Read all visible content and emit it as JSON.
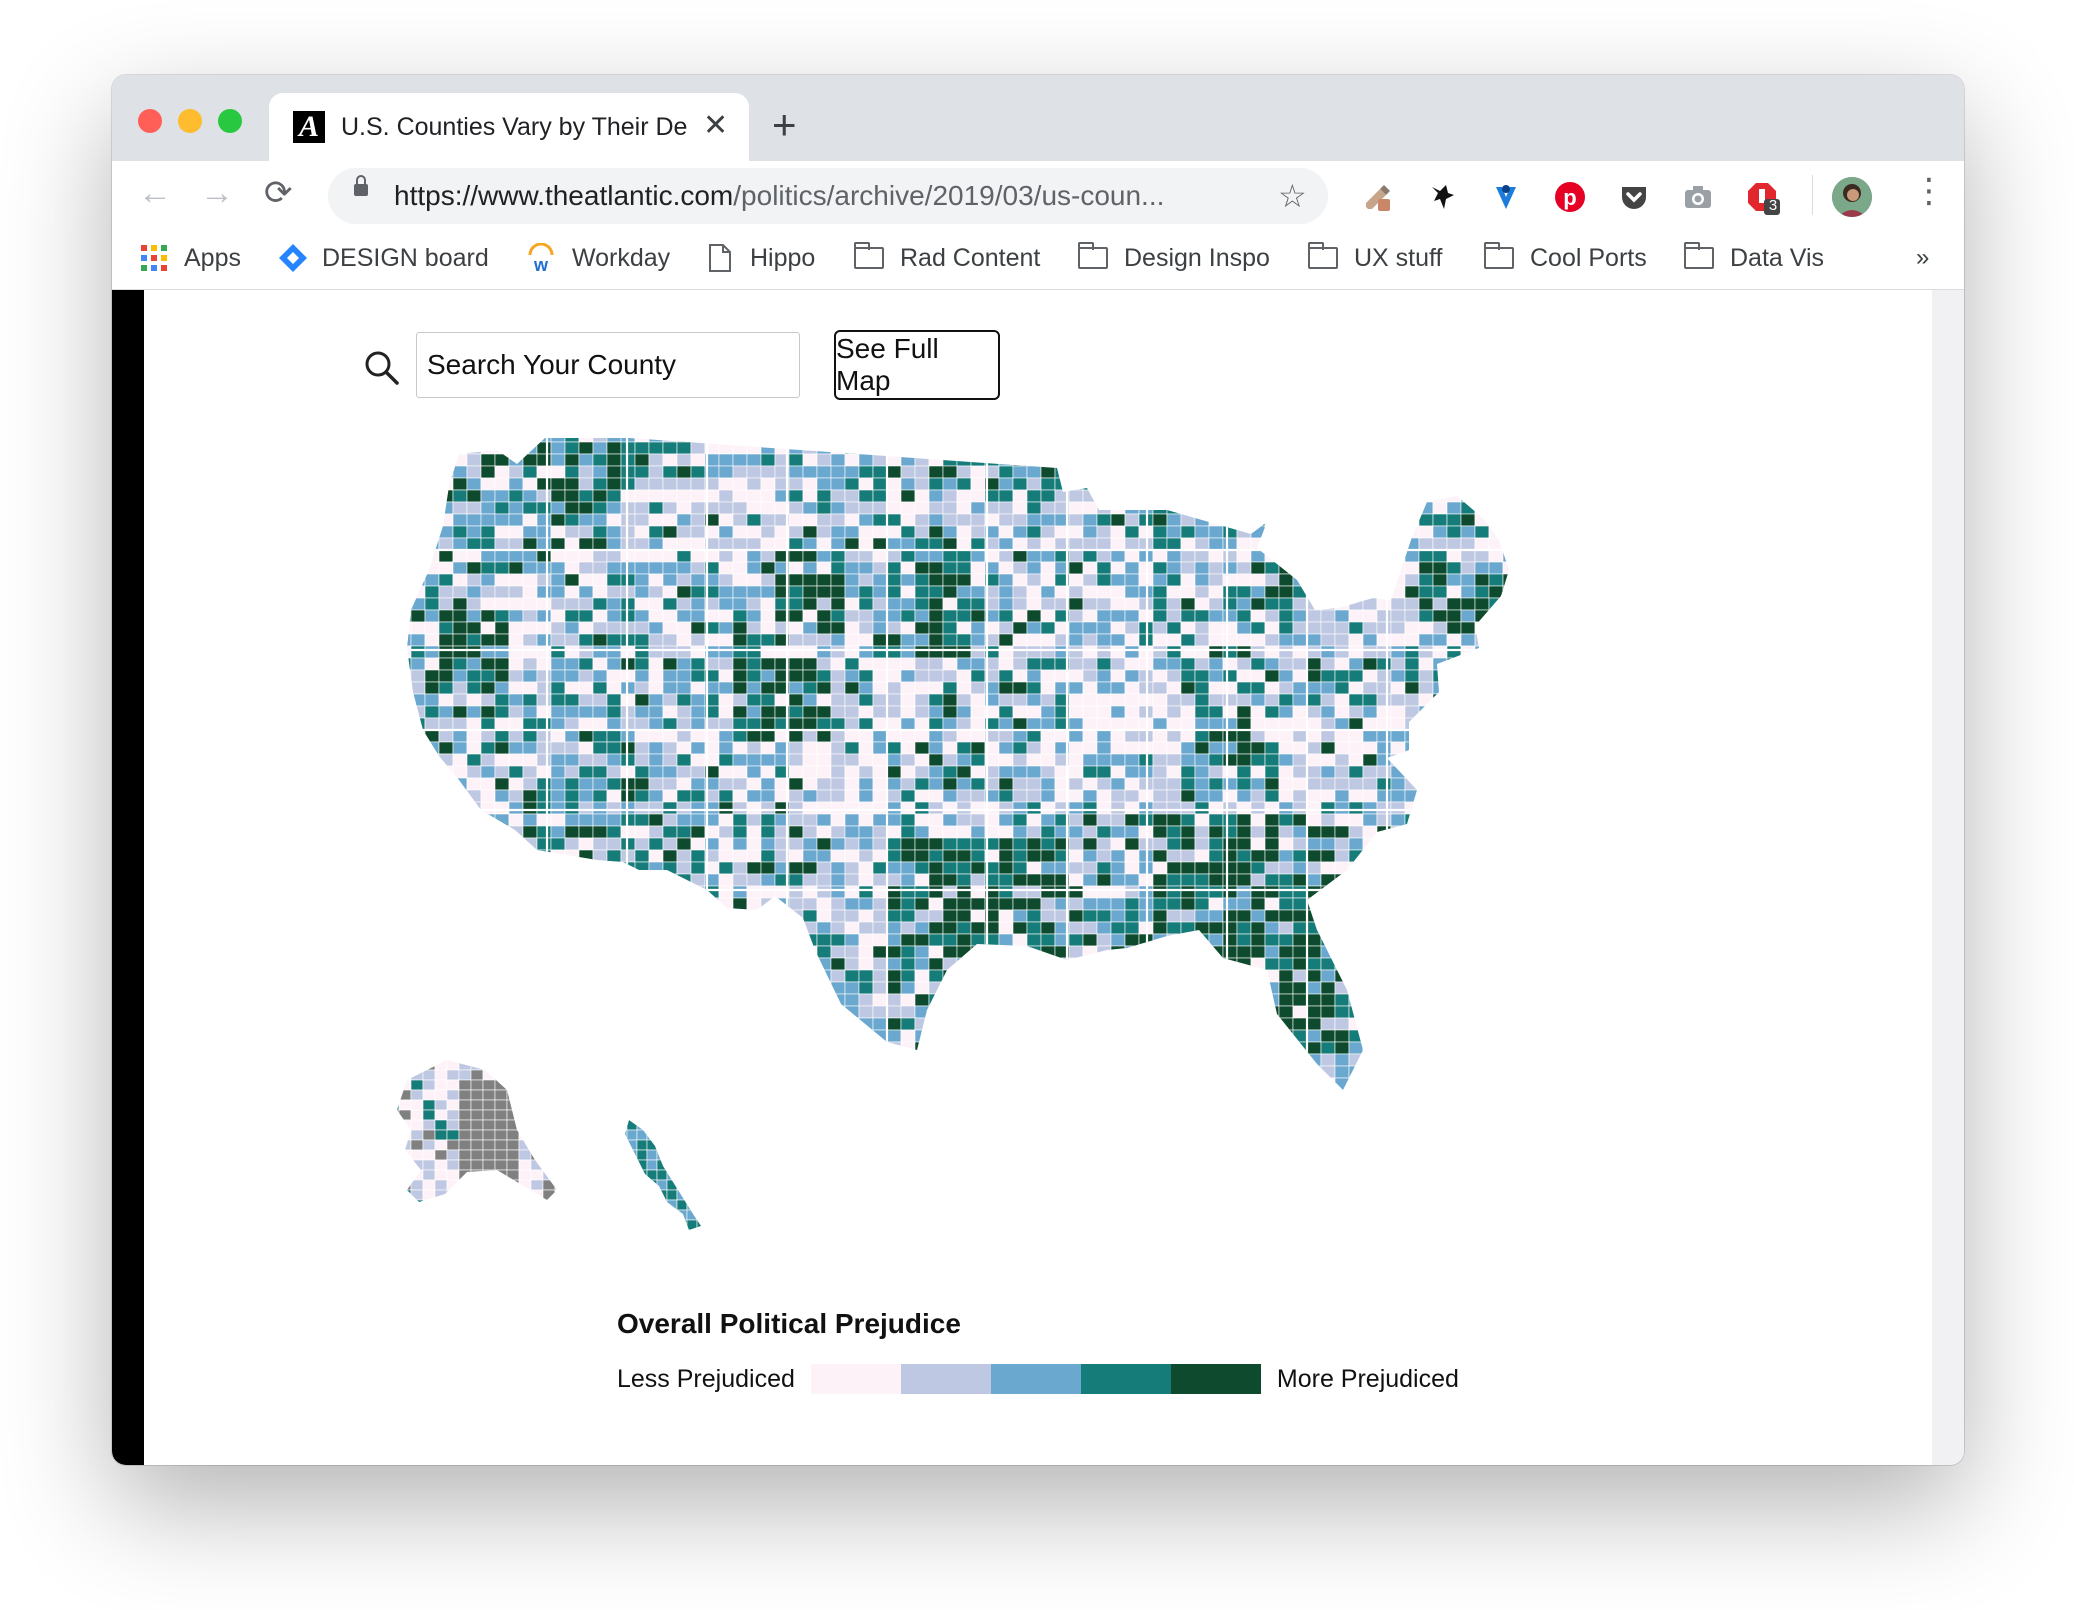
{
  "browser": {
    "tab": {
      "title": "U.S. Counties Vary by Their De",
      "favicon_letter": "A",
      "close_glyph": "✕"
    },
    "new_tab_glyph": "+",
    "nav": {
      "back": "←",
      "forward": "→",
      "reload": "⟳",
      "star": "☆",
      "menu": "⋮",
      "overflow": "»"
    },
    "url": {
      "scheme": "https://",
      "host": "www.theatlantic.com",
      "path": "/politics/archive/2019/03/us-coun..."
    },
    "extensions": [
      "eyedropper-icon",
      "bat-icon",
      "vimeo-icon",
      "pinterest-icon",
      "pocket-icon",
      "camera-icon",
      "adblock-icon",
      "profile-avatar"
    ],
    "adblock_badge": "3",
    "bookmarks": [
      {
        "label": "Apps",
        "icon": "apps-grid-icon"
      },
      {
        "label": "DESIGN board",
        "icon": "diamond-icon"
      },
      {
        "label": "Workday",
        "icon": "workday-icon"
      },
      {
        "label": "Hippo",
        "icon": "page-icon"
      },
      {
        "label": "Rad Content",
        "icon": "folder-icon"
      },
      {
        "label": "Design Inspo",
        "icon": "folder-icon"
      },
      {
        "label": "UX stuff",
        "icon": "folder-icon"
      },
      {
        "label": "Cool Ports",
        "icon": "folder-icon"
      },
      {
        "label": "Data Vis",
        "icon": "folder-icon"
      }
    ]
  },
  "page": {
    "search": {
      "placeholder": "Search Your County"
    },
    "full_map_button": "See Full Map",
    "legend": {
      "title": "Overall Political Prejudice",
      "low_label": "Less Prejudiced",
      "high_label": "More Prejudiced",
      "colors": [
        "#fdf2f8",
        "#bfc8e2",
        "#6aa8cf",
        "#167c7a",
        "#0d4a2e"
      ]
    }
  },
  "map": {
    "type": "choropleth",
    "nodata_color": "#808080",
    "palette": [
      "#fdf2f8",
      "#bfc8e2",
      "#6aa8cf",
      "#167c7a",
      "#0d4a2e"
    ]
  }
}
